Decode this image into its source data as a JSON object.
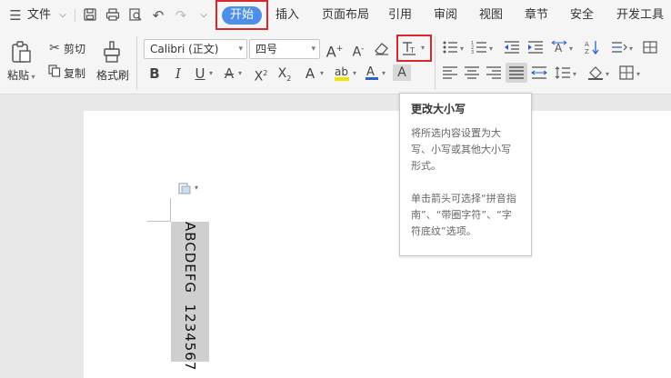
{
  "menu": {
    "file_label": "文件"
  },
  "tabs": [
    {
      "label": "开始",
      "active": true
    },
    {
      "label": "插入"
    },
    {
      "label": "页面布局"
    },
    {
      "label": "引用"
    },
    {
      "label": "审阅"
    },
    {
      "label": "视图"
    },
    {
      "label": "章节"
    },
    {
      "label": "安全"
    },
    {
      "label": "开发工具"
    }
  ],
  "clipboard": {
    "paste": "粘贴",
    "cut": "剪切",
    "copy": "复制",
    "format_painter": "格式刷"
  },
  "font": {
    "family": "Calibri (正文)",
    "size": "四号"
  },
  "tooltip": {
    "title": "更改大小写",
    "body1": "将所选内容设置为大写、小写或其他大小写形式。",
    "body2": "单击箭头可选择“拼音指南”、“带圈字符”、“字符底纹”选项。"
  },
  "document": {
    "vertical_text": "ABCDEFG  1234567"
  },
  "colors": {
    "accent": "#4d8ee8",
    "highlight_red": "#d9272e",
    "font_color": "#2a62d0",
    "highlight_yellow": "#f6e400"
  }
}
